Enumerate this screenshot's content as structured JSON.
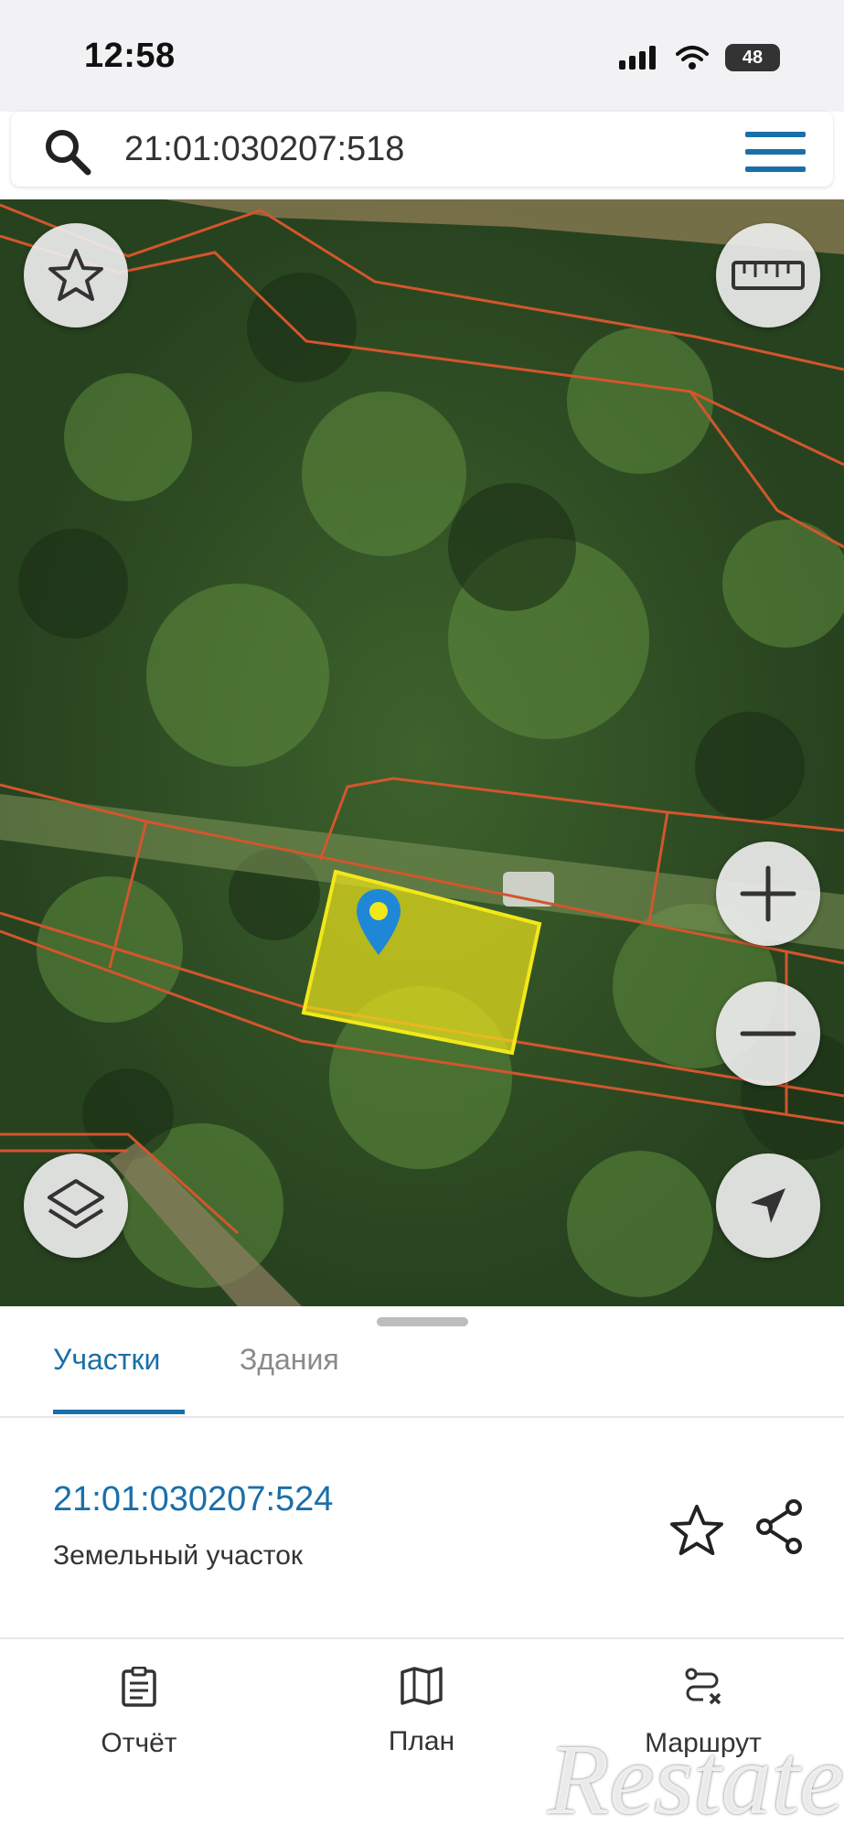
{
  "status_bar": {
    "time": "12:58",
    "battery": "48"
  },
  "search": {
    "query": "21:01:030207:518"
  },
  "bottom_sheet": {
    "tabs": [
      {
        "label": "Участки",
        "active": true
      },
      {
        "label": "Здания",
        "active": false
      }
    ],
    "parcel": {
      "id": "21:01:030207:524",
      "type": "Земельный участок"
    }
  },
  "bottom_nav": [
    {
      "label": "Отчёт",
      "icon": "report-icon"
    },
    {
      "label": "План",
      "icon": "map-icon"
    },
    {
      "label": "Маршрут",
      "icon": "route-icon"
    }
  ],
  "watermark": "Restate",
  "colors": {
    "accent": "#1b6fa8",
    "parcel_highlight": "#f2e81a",
    "boundary": "#d2562d",
    "pin": "#1e88d6"
  }
}
